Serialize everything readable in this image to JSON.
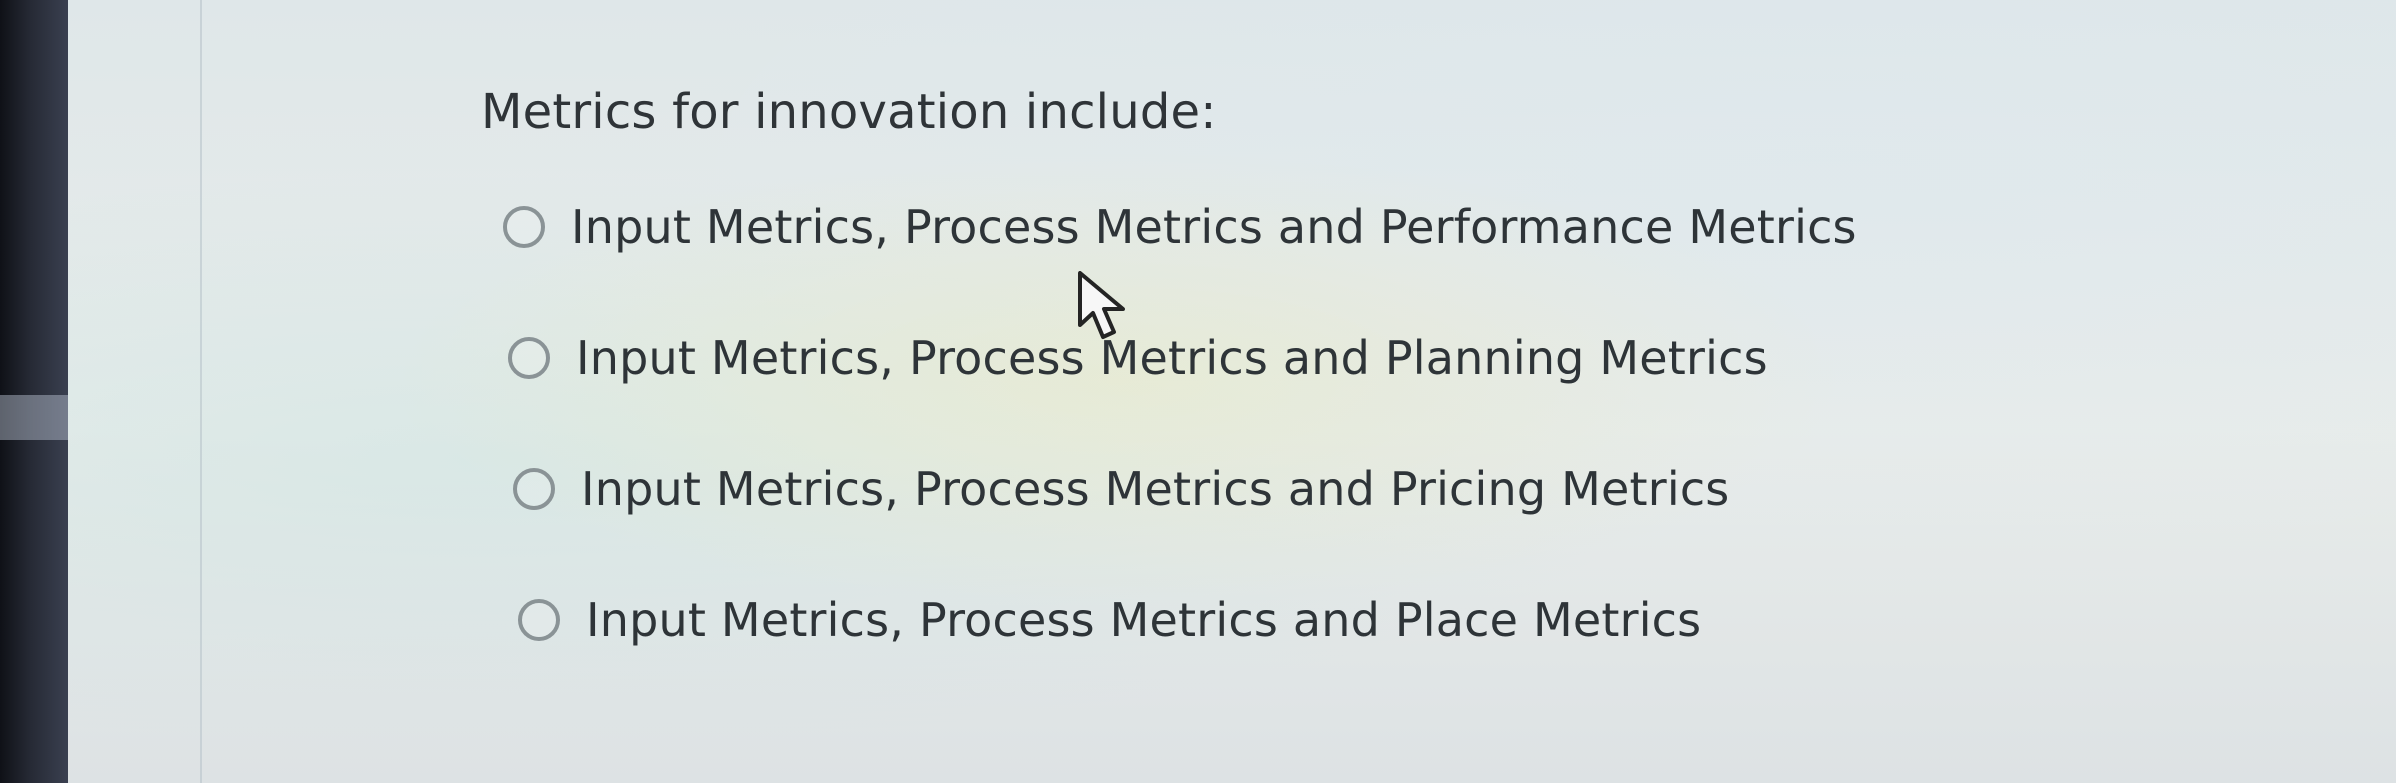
{
  "question": {
    "prompt": "Metrics for innovation include:"
  },
  "answer_options": [
    {
      "label": "Input Metrics, Process Metrics and Performance Metrics",
      "selected": false
    },
    {
      "label": "Input Metrics, Process Metrics and Planning Metrics",
      "selected": false
    },
    {
      "label": "Input Metrics, Process Metrics and Pricing Metrics",
      "selected": false
    },
    {
      "label": "Input Metrics, Process Metrics and Place Metrics",
      "selected": false
    }
  ],
  "cursor": {
    "icon": "pointer-cursor-icon"
  }
}
